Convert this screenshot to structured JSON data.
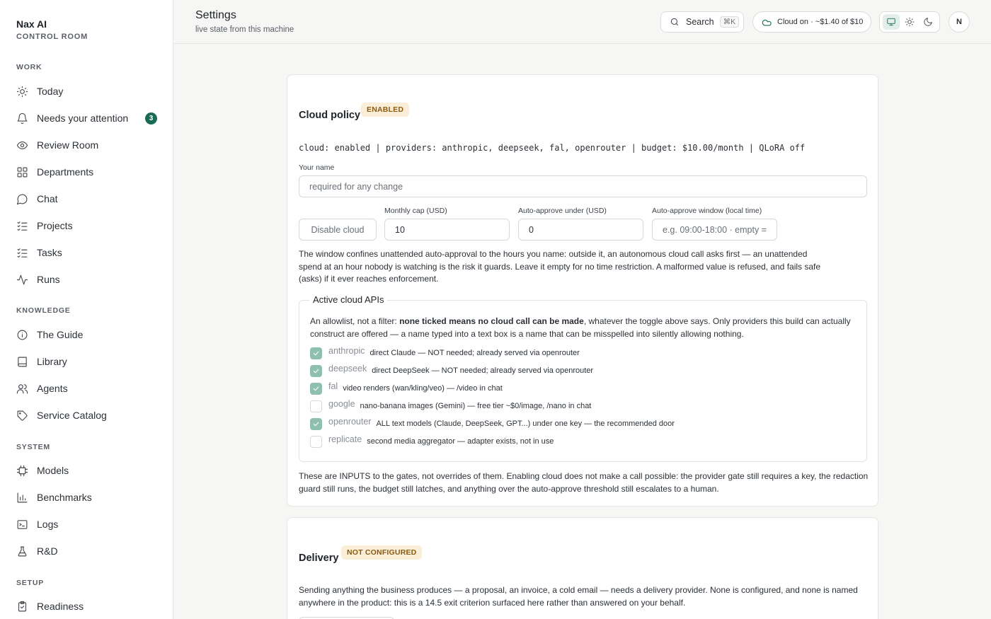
{
  "brand": {
    "name": "Nax AI",
    "sub": "CONTROL ROOM"
  },
  "sidebar": {
    "sections": [
      {
        "label": "WORK"
      },
      {
        "label": "KNOWLEDGE"
      },
      {
        "label": "SYSTEM"
      },
      {
        "label": "SETUP"
      }
    ],
    "items": [
      {
        "label": "Today",
        "icon": "sun-icon"
      },
      {
        "label": "Needs your attention",
        "icon": "bell-icon",
        "badge": "3"
      },
      {
        "label": "Review Room",
        "icon": "eye-icon"
      },
      {
        "label": "Departments",
        "icon": "grid-icon"
      },
      {
        "label": "Chat",
        "icon": "chat-bubble-icon"
      },
      {
        "label": "Projects",
        "icon": "list-check-icon"
      },
      {
        "label": "Tasks",
        "icon": "list-check-icon"
      },
      {
        "label": "Runs",
        "icon": "activity-icon"
      },
      {
        "label": "The Guide",
        "icon": "info-icon"
      },
      {
        "label": "Library",
        "icon": "book-icon"
      },
      {
        "label": "Agents",
        "icon": "users-icon"
      },
      {
        "label": "Service Catalog",
        "icon": "tag-icon"
      },
      {
        "label": "Models",
        "icon": "cpu-icon"
      },
      {
        "label": "Benchmarks",
        "icon": "bar-chart-icon"
      },
      {
        "label": "Logs",
        "icon": "terminal-icon"
      },
      {
        "label": "R&D",
        "icon": "flask-icon"
      },
      {
        "label": "Readiness",
        "icon": "clipboard-check-icon"
      }
    ]
  },
  "header": {
    "title": "Settings",
    "subtitle": "live state from this machine",
    "search_label": "Search",
    "search_shortcut": "⌘K",
    "cloud_status": "Cloud on · ~$1.40 of $10",
    "avatar_initial": "N"
  },
  "cloud_policy": {
    "title": "Cloud policy",
    "badge": "ENABLED",
    "summary": "cloud: enabled | providers: anthropic, deepseek, fal, openrouter | budget: $10.00/month | QLoRA off",
    "name_label": "Your name",
    "name_placeholder": "required for any change",
    "disable_button": "Disable cloud",
    "cap_label": "Monthly cap (USD)",
    "cap_value": "10",
    "auto_label": "Auto-approve under (USD)",
    "auto_value": "0",
    "window_label": "Auto-approve window (local time)",
    "window_placeholder": "e.g. 09:00-18:00 · empty =",
    "window_help": "The window confines unattended auto-approval to the hours you name: outside it, an autonomous cloud call asks first — an unattended spend at an hour nobody is watching is the risk it guards. Leave it empty for no time restriction. A malformed value is refused, and fails safe (asks) if it ever reaches enforcement.",
    "apis": {
      "legend": "Active cloud APIs",
      "intro_pre": "An allowlist, not a filter: ",
      "intro_bold": "none ticked means no cloud call can be made",
      "intro_post": ", whatever the toggle above says. Only providers this build can actually construct are offered — a name typed into a text box is a name that can be misspelled into silently allowing nothing.",
      "providers": [
        {
          "name": "anthropic",
          "desc": "direct Claude — NOT needed; already served via openrouter",
          "checked": true
        },
        {
          "name": "deepseek",
          "desc": "direct DeepSeek — NOT needed; already served via openrouter",
          "checked": true
        },
        {
          "name": "fal",
          "desc": "video renders (wan/kling/veo) — /video in chat",
          "checked": true
        },
        {
          "name": "google",
          "desc": "nano-banana images (Gemini) — free tier ~$0/image, /nano in chat",
          "checked": false
        },
        {
          "name": "openrouter",
          "desc": "ALL text models (Claude, DeepSeek, GPT...) under one key — the recommended door",
          "checked": true
        },
        {
          "name": "replicate",
          "desc": "second media aggregator — adapter exists, not in use",
          "checked": false
        }
      ]
    },
    "footer_note": "These are INPUTS to the gates, not overrides of them. Enabling cloud does not make a call possible: the provider gate still requires a key, the redaction guard still runs, the budget still latches, and anything over the auto-approve threshold still escalates to a human."
  },
  "delivery": {
    "title": "Delivery",
    "badge": "NOT CONFIGURED",
    "text": "Sending anything the business produces — a proposal, an invoice, a cold email — needs a delivery provider. None is configured, and none is named anywhere in the product: this is a 14.5 exit criterion surfaced here rather than answered on your behalf."
  },
  "colors": {
    "accent": "#1a6b55",
    "badge_bg": "#fbeed6",
    "badge_text": "#8a5a12",
    "checkbox_on": "#8ebfb0"
  }
}
